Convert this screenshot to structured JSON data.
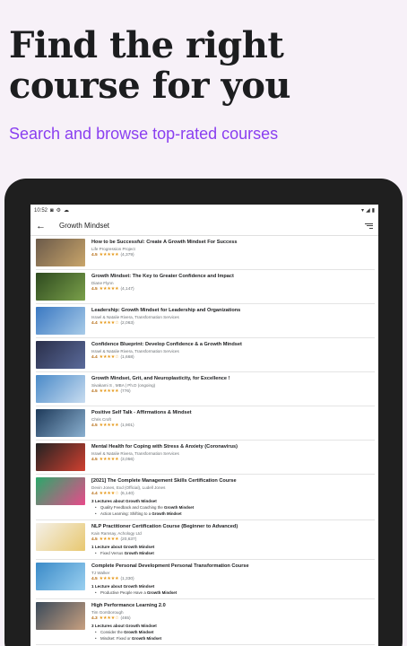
{
  "hero": {
    "title_line1": "Find the right",
    "title_line2": "course for you",
    "subtitle": "Search and browse top-rated courses",
    "subtitle_color": "#8a3ff0"
  },
  "status": {
    "time": "10:52"
  },
  "search": {
    "query": "Growth Mindset"
  },
  "courses": [
    {
      "title": "How to be Successful: Create A Growth Mindset For Success",
      "author": "Life Progression Project",
      "rating": "4.5",
      "stars": "★★★★★",
      "count": "(4,379)",
      "thumb": [
        "#6b5a4a",
        "#c9a56a"
      ]
    },
    {
      "title": "Growth Mindset: The Key to Greater Confidence and Impact",
      "author": "Diane Flynn",
      "rating": "4.5",
      "stars": "★★★★★",
      "count": "(4,147)",
      "thumb": [
        "#2e4a1f",
        "#7aa04a"
      ]
    },
    {
      "title": "Leadership: Growth Mindset for Leadership and Organizations",
      "author": "Israel & Natalie Rivera, Transformation Services",
      "rating": "4.4",
      "stars": "★★★★☆",
      "count": "(2,063)",
      "thumb": [
        "#3a78c2",
        "#a8cbe8"
      ]
    },
    {
      "title": "Confidence Blueprint: Develop Confidence & a Growth Mindset",
      "author": "Israel & Natalie Rivera, Transformation Services",
      "rating": "4.4",
      "stars": "★★★★☆",
      "count": "(1,668)",
      "thumb": [
        "#2a2f4a",
        "#5a6a9a"
      ]
    },
    {
      "title": "Growth Mindset, Grit, and Neuroplasticity, for Excellence !",
      "author": "Sivakami S , MBA | Ph.D (ongoing)",
      "rating": "4.5",
      "stars": "★★★★★",
      "count": "(776)",
      "thumb": [
        "#4a8ac8",
        "#c8dcf0"
      ]
    },
    {
      "title": "Positive Self Talk - Affirmations & Mindset",
      "author": "Chris Croft",
      "rating": "4.5",
      "stars": "★★★★★",
      "count": "(1,901)",
      "thumb": [
        "#1e3a5a",
        "#8ab0d0"
      ]
    },
    {
      "title": "Mental Health for Coping with Stress & Anxiety (Coronavirus)",
      "author": "Israel & Natalie Rivera, Transformation Services",
      "rating": "4.5",
      "stars": "★★★★★",
      "count": "(3,056)",
      "thumb": [
        "#222222",
        "#d04030"
      ]
    },
    {
      "title": "[2021] The Complete Management Skills Certification Course",
      "author": "Devin Jones, Exd (Official), Ludell Jones",
      "rating": "4.4",
      "stars": "★★★★☆",
      "count": "(6,140)",
      "thumb": [
        "#2aa86a",
        "#e84a8a"
      ],
      "lectures": "3 Lectures about Growth Mindset",
      "items": [
        [
          "Quality Feedback and Coaching the ",
          "Growth Mindset"
        ],
        [
          "Action Learning: Shifting to a ",
          "Growth Mindset"
        ]
      ]
    },
    {
      "title": "NLP Practitioner Certification Course (Beginner to Advanced)",
      "author": "Kain Ramsay, Achology Ltd",
      "rating": "4.5",
      "stars": "★★★★★",
      "count": "(20,637)",
      "thumb": [
        "#f4f0e8",
        "#e8c870"
      ],
      "lectures": "1 Lecture about Growth Mindset",
      "items": [
        [
          "Fixed Versus ",
          "Growth Mindset"
        ]
      ]
    },
    {
      "title": "Complete Personal Development Personal Transformation Course",
      "author": "TJ Walker",
      "rating": "4.5",
      "stars": "★★★★★",
      "count": "(1,330)",
      "thumb": [
        "#3a8ac8",
        "#9ad0f0"
      ],
      "lectures": "1 Lecture about Growth Mindset",
      "items": [
        [
          "Productive People Have a ",
          "Growth Mindset"
        ]
      ]
    },
    {
      "title": "High Performance Learning 2.0",
      "author": "Tim Gorsborough",
      "rating": "4.3",
      "stars": "★★★★☆",
      "count": "(465)",
      "thumb": [
        "#3a4a5a",
        "#c8a080"
      ],
      "lectures": "3 Lectures about Growth Mindset",
      "items": [
        [
          "Consider the ",
          "Growth Mindset"
        ],
        [
          "Mindset: Fixed or ",
          "Growth Mindset"
        ]
      ]
    }
  ]
}
